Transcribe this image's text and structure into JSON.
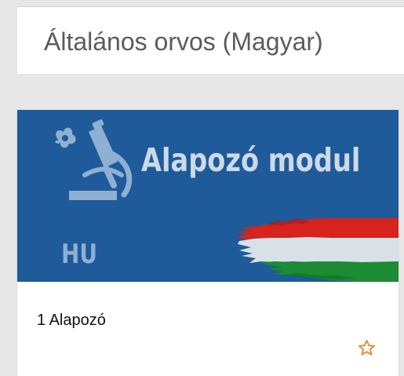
{
  "header": {
    "title": "Általános orvos (Magyar)"
  },
  "course": {
    "banner_title": "Alapozó modul",
    "banner_code": "HU",
    "title": "1 Alapozó"
  },
  "icons": {
    "banner_icon": "microscope-icon",
    "favorite": "star-outline-icon",
    "flag": "hungarian-flag-icon"
  },
  "colors": {
    "banner_blue": "#1f5a9a",
    "star_orange": "#e08b2f",
    "flag_red": "#d7221d",
    "flag_white": "#d8e1e8",
    "flag_green": "#1b8b34"
  }
}
